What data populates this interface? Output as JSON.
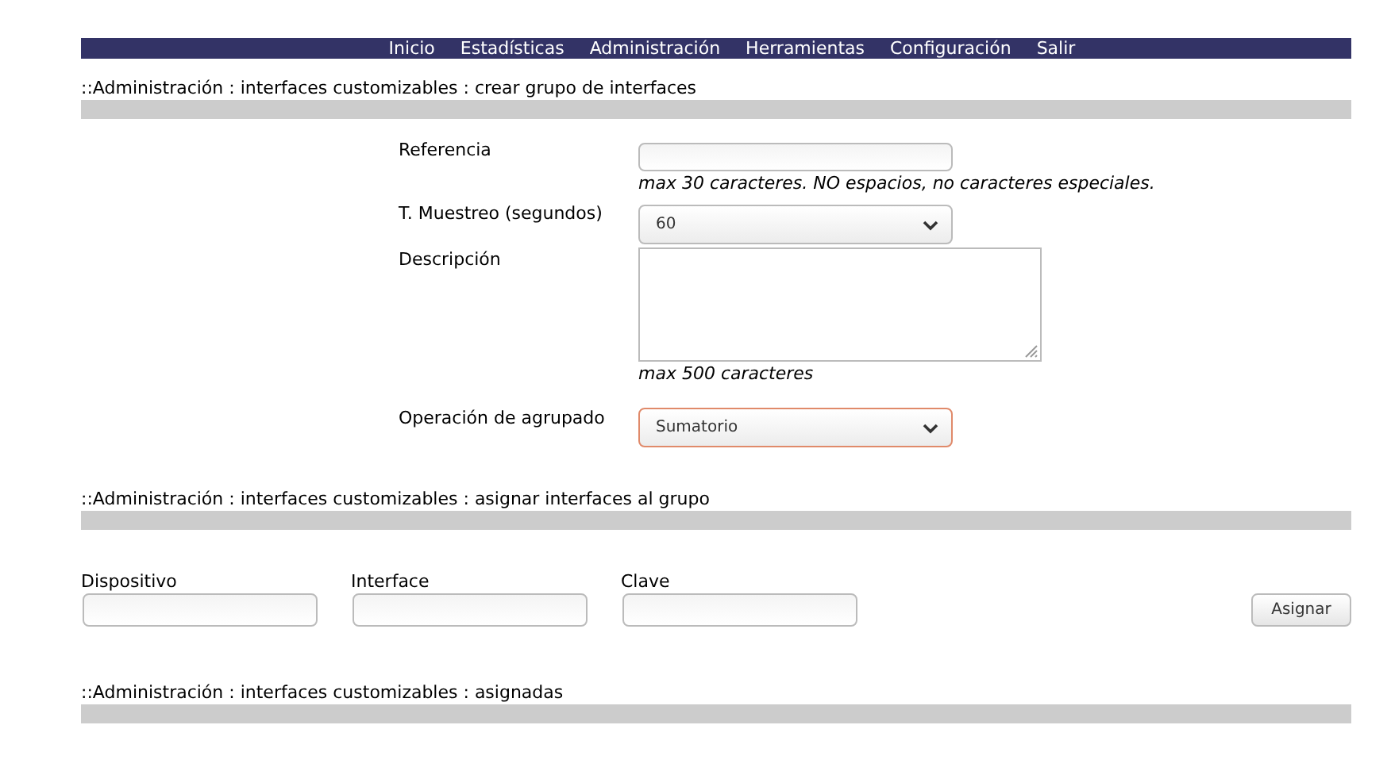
{
  "nav": [
    "Inicio",
    "Estadísticas",
    "Administración",
    "Herramientas",
    "Configuración",
    "Salir"
  ],
  "section_1": {
    "title": "::Administración : interfaces customizables : crear grupo de interfaces"
  },
  "form": {
    "referencia": {
      "label": "Referencia",
      "hint": "max 30 caracteres. NO espacios, no caracteres especiales."
    },
    "muestreo": {
      "label": "T. Muestreo (segundos)",
      "value": "60"
    },
    "descripcion": {
      "label": "Descripción",
      "hint": "max 500 caracteres"
    },
    "operacion": {
      "label": "Operación de agrupado",
      "value": "Sumatorio",
      "focused": true
    }
  },
  "section_2": {
    "title": "::Administración : interfaces customizables : asignar interfaces al grupo"
  },
  "assign_fields": [
    {
      "label": "Dispositivo"
    },
    {
      "label": "Interface"
    },
    {
      "label": "Clave"
    }
  ],
  "assign_button": "Asignar",
  "section_3": {
    "title": "::Administración : interfaces customizables : asignadas"
  }
}
